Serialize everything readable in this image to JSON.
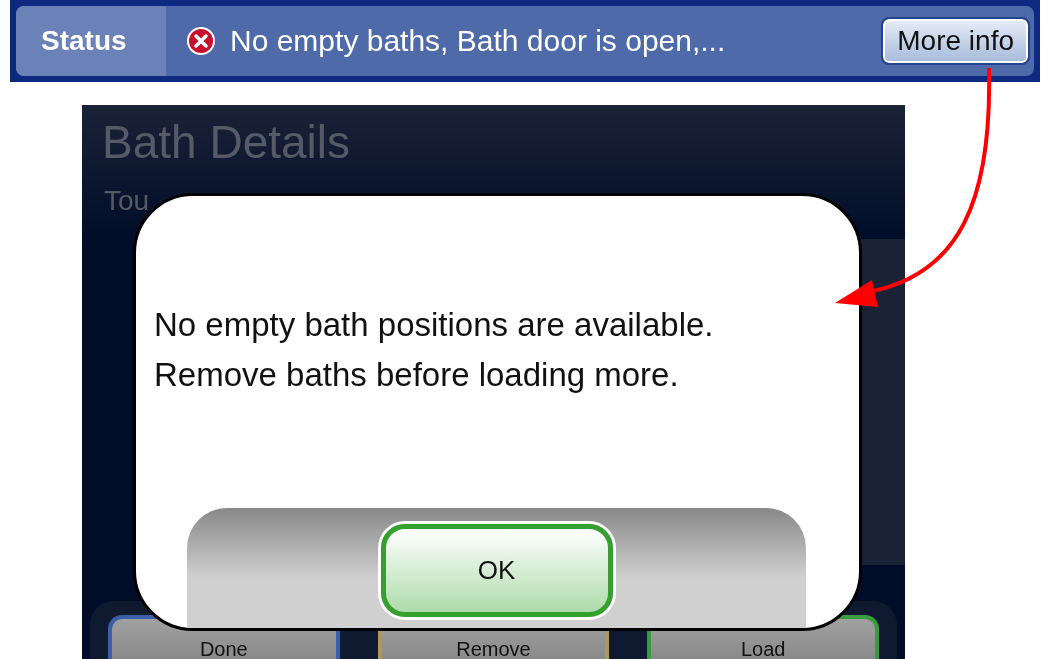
{
  "status_bar": {
    "label": "Status",
    "message": "No empty baths, Bath door is open,...",
    "button": "More info"
  },
  "screen": {
    "title": "Bath Details",
    "subtitle": "Tou",
    "buttons": [
      {
        "label": "Done",
        "color": "#3a5ea8"
      },
      {
        "label": "Remove",
        "color": "#b09858"
      },
      {
        "label": "Load",
        "color": "#3a9a40"
      }
    ]
  },
  "dialog": {
    "lines": [
      "No empty bath positions are available.",
      "Remove baths before loading more."
    ],
    "button": "OK"
  }
}
